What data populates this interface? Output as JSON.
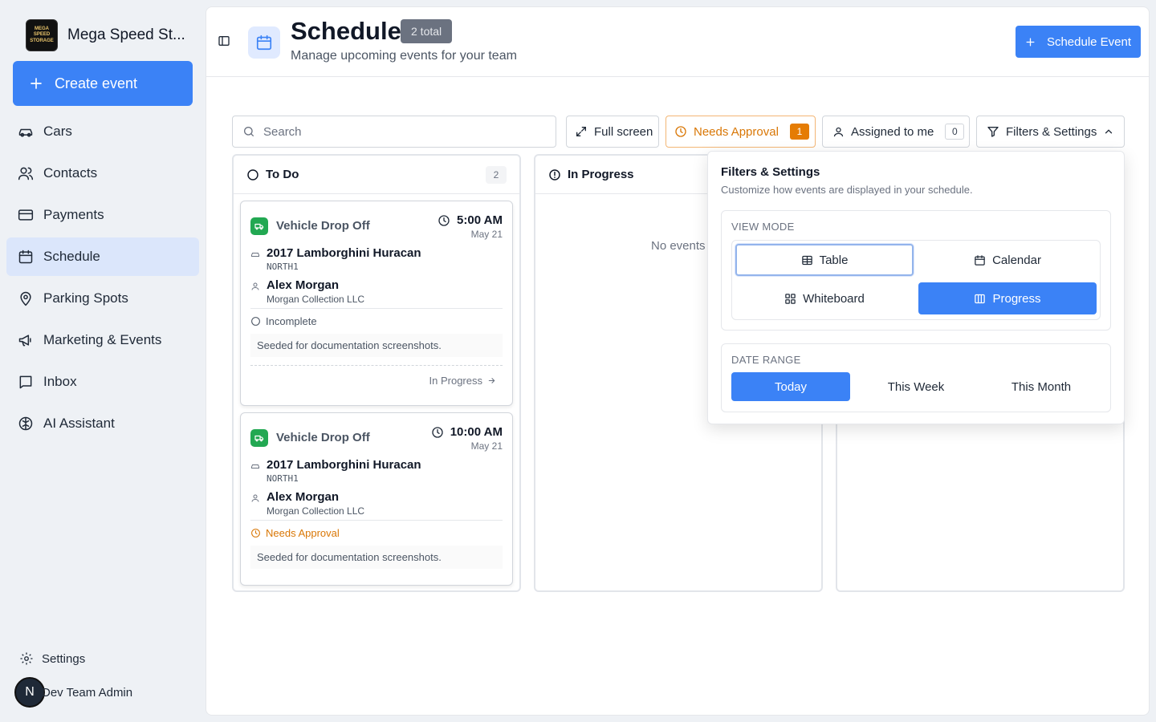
{
  "app": {
    "brand_name": "Mega Speed St...",
    "logo_text": [
      "MEGA SPEED",
      "STORAGE"
    ],
    "create_label": "Create event"
  },
  "sidebar": {
    "items": [
      {
        "label": "Cars",
        "icon": "car-icon"
      },
      {
        "label": "Contacts",
        "icon": "users-icon"
      },
      {
        "label": "Payments",
        "icon": "credit-card-icon"
      },
      {
        "label": "Schedule",
        "icon": "calendar-icon",
        "active": true
      },
      {
        "label": "Parking Spots",
        "icon": "map-pin-icon"
      },
      {
        "label": "Marketing & Events",
        "icon": "megaphone-icon"
      },
      {
        "label": "Inbox",
        "icon": "inbox-icon"
      },
      {
        "label": "AI Assistant",
        "icon": "brain-icon"
      }
    ],
    "settings_label": "Settings",
    "user_initial": "N",
    "user_name": "Dev Team Admin"
  },
  "header": {
    "title": "Schedule",
    "total_badge": "2 total",
    "subtitle": "Manage upcoming events for your team",
    "schedule_button": "Schedule Event"
  },
  "toolbar": {
    "search_placeholder": "Search",
    "fullscreen_label": "Full screen",
    "approval_label": "Needs Approval",
    "approval_count": "1",
    "assigned_label": "Assigned to me",
    "assigned_count": "0",
    "filters_label": "Filters & Settings"
  },
  "columns": [
    {
      "title": "To Do",
      "count": "2"
    },
    {
      "title": "In Progress",
      "empty": "No events"
    },
    {
      "title": ""
    }
  ],
  "cards": [
    {
      "type": "Vehicle Drop Off",
      "time": "5:00 AM",
      "date": "May 21",
      "vehicle": "2017 Lamborghini Huracan",
      "plate": "NORTH1",
      "contact": "Alex Morgan",
      "company": "Morgan Collection LLC",
      "status": "Incomplete",
      "note": "Seeded for documentation screenshots.",
      "action": "In Progress"
    },
    {
      "type": "Vehicle Drop Off",
      "time": "10:00 AM",
      "date": "May 21",
      "vehicle": "2017 Lamborghini Huracan",
      "plate": "NORTH1",
      "contact": "Alex Morgan",
      "company": "Morgan Collection LLC",
      "status": "Needs Approval",
      "note": "Seeded for documentation screenshots."
    }
  ],
  "popover": {
    "title": "Filters & Settings",
    "subtitle": "Customize how events are displayed in your schedule.",
    "view_mode_label": "VIEW MODE",
    "view_modes": [
      "Table",
      "Calendar",
      "Whiteboard",
      "Progress"
    ],
    "view_mode_selected": "Progress",
    "date_range_label": "DATE RANGE",
    "date_ranges": [
      "Today",
      "This Week",
      "This Month"
    ],
    "date_range_selected": "Today"
  },
  "colors": {
    "accent": "#3b82f6",
    "warning": "#d97706",
    "success": "#22a852"
  }
}
